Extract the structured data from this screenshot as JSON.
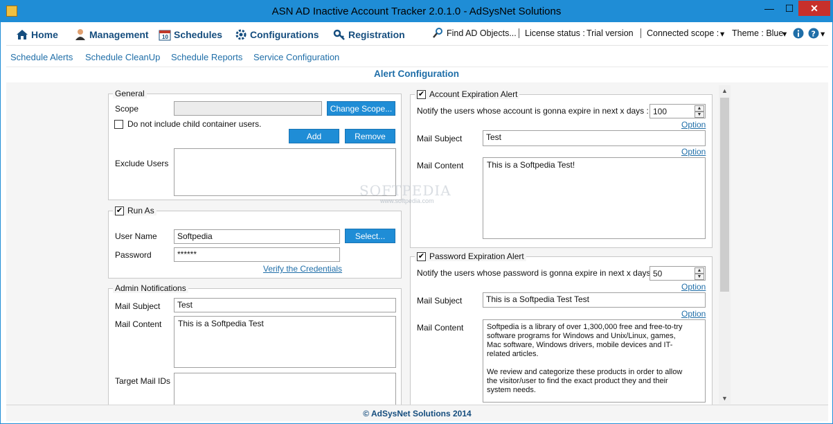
{
  "window": {
    "title": "ASN AD Inactive Account Tracker 2.0.1.0 - AdSysNet Solutions",
    "min_label": "—",
    "max_label": "☐",
    "close_label": "✕"
  },
  "menu": {
    "items": [
      {
        "label": "Home",
        "icon": "home-icon"
      },
      {
        "label": "Management",
        "icon": "user-icon"
      },
      {
        "label": "Schedules",
        "icon": "calendar-icon"
      },
      {
        "label": "Configurations",
        "icon": "gear-icon"
      },
      {
        "label": "Registration",
        "icon": "key-icon"
      }
    ],
    "find": "Find AD Objects...",
    "license_label": "License status :",
    "license_value": "Trial version",
    "scope_label": "Connected scope :",
    "theme_label": "Theme : Blue",
    "caret": "▾"
  },
  "subtabs": [
    "Schedule Alerts",
    "Schedule CleanUp",
    "Schedule Reports",
    "Service Configuration"
  ],
  "heading": "Alert Configuration",
  "general": {
    "title": "General",
    "scope_label": "Scope",
    "scope_value": "",
    "change_scope": "Change Scope...",
    "child_label": "Do not include child container users.",
    "add": "Add",
    "remove": "Remove",
    "exclude_label": "Exclude  Users"
  },
  "runas": {
    "title": "Run As",
    "checked": "✔",
    "user_label": "User Name",
    "user_value": "Softpedia",
    "select": "Select...",
    "password_label": "Password",
    "password_value": "******",
    "verify": "Verify the Credentials"
  },
  "admin": {
    "title": "Admin Notifications",
    "subject_label": "Mail Subject",
    "subject_value": "Test",
    "content_label": "Mail Content",
    "content_value": "This is a Softpedia Test",
    "target_label": "Target Mail IDs"
  },
  "account_alert": {
    "title": "Account Expiration Alert",
    "checked": "✔",
    "notify_label": "Notify the users whose account is gonna expire in next x days :",
    "days": "100",
    "option1": "Option",
    "subject_label": "Mail Subject",
    "subject_value": "Test",
    "option2": "Option",
    "content_label": "Mail Content",
    "content_value": "This is a Softpedia Test!"
  },
  "password_alert": {
    "title": "Password Expiration Alert",
    "checked": "✔",
    "notify_label": "Notify the users whose password is gonna expire in next x days :",
    "days": "50",
    "option1": "Option",
    "subject_label": "Mail Subject",
    "subject_value": "This is a Softpedia Test Test",
    "option2": "Option",
    "content_label": "Mail Content",
    "content_value": "Softpedia is a library of over 1,300,000 free and free-to-try\nsoftware programs for Windows and Unix/Linux, games,\nMac software, Windows drivers, mobile devices and IT-\nrelated articles.\n\nWe review and categorize these products in order to allow\nthe visitor/user to find the exact product they and their\nsystem needs."
  },
  "watermark": {
    "text": "SOFTPEDIA",
    "sub": "www.softpedia.com"
  },
  "footer": "© AdSysNet Solutions 2014",
  "colors": {
    "accent": "#1f8dd6",
    "nav": "#154d7e",
    "trial": "#e07b00"
  }
}
